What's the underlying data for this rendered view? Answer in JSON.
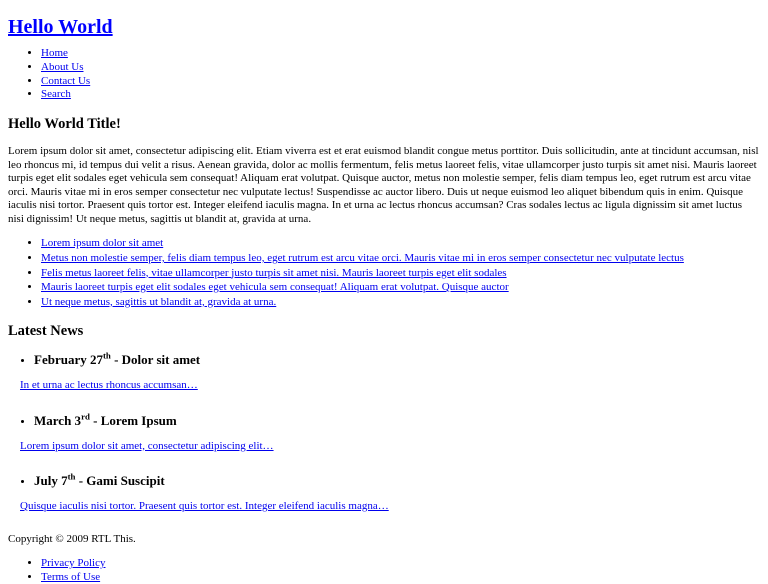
{
  "site": {
    "title": "Hello World"
  },
  "nav": {
    "items": [
      {
        "label": "Home"
      },
      {
        "label": "About Us"
      },
      {
        "label": "Contact Us"
      },
      {
        "label": "Search"
      }
    ]
  },
  "main": {
    "heading": "Hello World Title!",
    "paragraph": "Lorem ipsum dolor sit amet, consectetur adipiscing elit. Etiam viverra est et erat euismod blandit congue metus porttitor. Duis sollicitudin, ante at tincidunt accumsan, nisl leo rhoncus mi, id tempus dui velit a risus. Aenean gravida, dolor ac mollis fermentum, felis metus laoreet felis, vitae ullamcorper justo turpis sit amet nisi. Mauris laoreet turpis eget elit sodales eget vehicula sem consequat! Aliquam erat volutpat. Quisque auctor, metus non molestie semper, felis diam tempus leo, eget rutrum est arcu vitae orci. Mauris vitae mi in eros semper consectetur nec vulputate lectus! Suspendisse ac auctor libero. Duis ut neque euismod leo aliquet bibendum quis in enim. Quisque iaculis nisi tortor. Praesent quis tortor est. Integer eleifend iaculis magna. In et urna ac lectus rhoncus accumsan? Cras sodales lectus ac ligula dignissim sit amet luctus nisi dignissim! Ut neque metus, sagittis ut blandit at, gravida at urna.",
    "link_list": [
      {
        "label": "Lorem ipsum dolor sit amet"
      },
      {
        "label": "Metus non molestie semper, felis diam tempus leo, eget rutrum est arcu vitae orci. Mauris vitae mi in eros semper consectetur nec vulputate lectus"
      },
      {
        "label": "Felis metus laoreet felis, vitae ullamcorper justo turpis sit amet nisi. Mauris laoreet turpis eget elit sodales"
      },
      {
        "label": "Mauris laoreet turpis eget elit sodales eget vehicula sem consequat! Aliquam erat volutpat. Quisque auctor"
      },
      {
        "label": "Ut neque metus, sagittis ut blandit at, gravida at urna."
      }
    ]
  },
  "news": {
    "heading": "Latest News",
    "items": [
      {
        "month_day": "February 27",
        "ordinal": "th",
        "separator": " - ",
        "title": "Dolor sit amet",
        "excerpt": "In et urna ac lectus rhoncus accumsan…"
      },
      {
        "month_day": "March 3",
        "ordinal": "rd",
        "separator": " - ",
        "title": "Lorem Ipsum",
        "excerpt": "Lorem ipsum dolor sit amet, consectetur adipiscing elit…"
      },
      {
        "month_day": "July 7",
        "ordinal": "th",
        "separator": " - ",
        "title": "Gami Suscipit",
        "excerpt": "Quisque iaculis nisi tortor. Praesent quis tortor est. Integer eleifend iaculis magna…"
      }
    ]
  },
  "footer": {
    "copyright": "Copyright © 2009 RTL This.",
    "links": [
      {
        "label": "Privacy Policy"
      },
      {
        "label": "Terms of Use"
      }
    ]
  },
  "colors": {
    "link": "#0000ee",
    "title_link": "#0000ff",
    "text": "#000000",
    "background": "#ffffff"
  }
}
